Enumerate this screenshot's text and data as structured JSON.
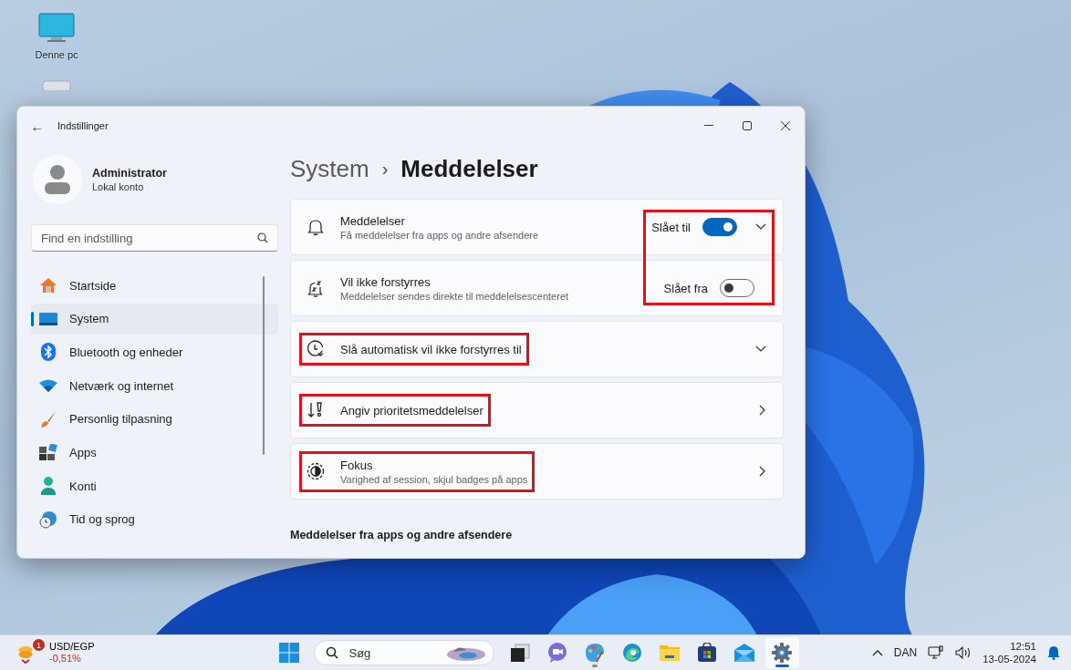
{
  "desktop": {
    "icons": [
      {
        "label": "Denne pc"
      }
    ]
  },
  "window": {
    "title": "Indstillinger",
    "back": "←"
  },
  "profile": {
    "name": "Administrator",
    "account": "Lokal konto"
  },
  "search": {
    "placeholder": "Find en indstilling"
  },
  "sidebar": {
    "items": [
      {
        "label": "Startside",
        "selected": false
      },
      {
        "label": "System",
        "selected": true
      },
      {
        "label": "Bluetooth og enheder",
        "selected": false
      },
      {
        "label": "Netværk og internet",
        "selected": false
      },
      {
        "label": "Personlig tilpasning",
        "selected": false
      },
      {
        "label": "Apps",
        "selected": false
      },
      {
        "label": "Konti",
        "selected": false
      },
      {
        "label": "Tid og sprog",
        "selected": false
      }
    ]
  },
  "breadcrumb": {
    "parent": "System",
    "separator": "›",
    "current": "Meddelelser"
  },
  "cards": [
    {
      "kind": "toggle",
      "title": "Meddelelser",
      "subtitle": "Få meddelelser fra apps og andre afsendere",
      "toggle_label": "Slået til",
      "on": true,
      "expandable": true,
      "highlighted": true
    },
    {
      "kind": "toggle",
      "title": "Vil ikke forstyrres",
      "subtitle": "Meddelelser sendes direkte til meddelelsescenteret",
      "toggle_label": "Slået fra",
      "on": false,
      "expandable": false,
      "highlighted": true
    },
    {
      "kind": "expander",
      "title": "Slå automatisk vil ikke forstyrres til",
      "highlighted": true
    },
    {
      "kind": "link",
      "title": "Angiv prioritetsmeddelelser",
      "highlighted": true
    },
    {
      "kind": "link",
      "title": "Fokus",
      "subtitle": "Varighed af session, skjul badges på apps",
      "highlighted": true
    }
  ],
  "section_heading": "Meddelelser fra apps og andre afsendere",
  "taskbar": {
    "widget": {
      "badge": "1",
      "title": "USD/EGP",
      "value": "-0,51%"
    },
    "search": {
      "label": "Søg"
    },
    "apps": [
      {
        "running": false,
        "selected": false
      },
      {
        "running": false,
        "selected": false
      },
      {
        "running": false,
        "selected": false
      },
      {
        "running": true,
        "selected": false
      },
      {
        "running": false,
        "selected": false
      },
      {
        "running": false,
        "selected": false
      },
      {
        "running": false,
        "selected": false
      },
      {
        "running": false,
        "selected": false
      },
      {
        "running": true,
        "selected": true
      }
    ],
    "language": "DAN",
    "time": "12:51",
    "date": "13-05-2024"
  }
}
